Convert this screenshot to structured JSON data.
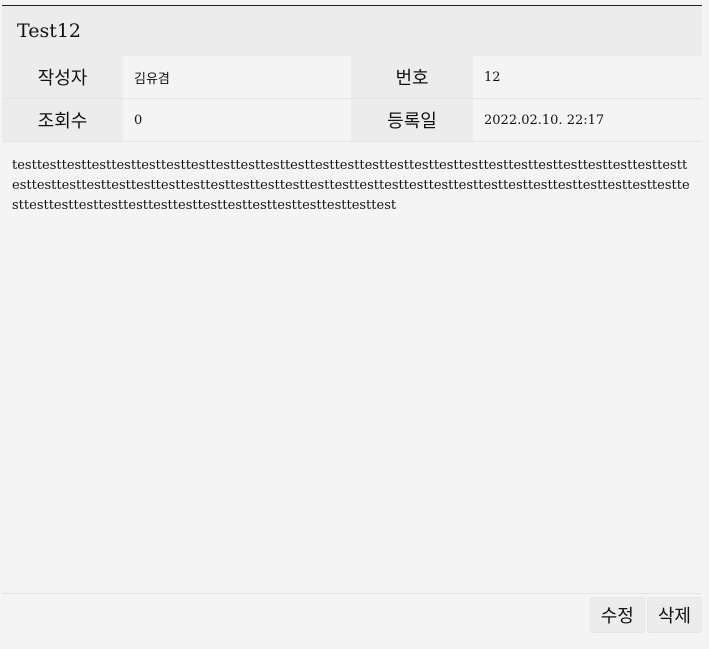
{
  "post": {
    "title": "Test12",
    "meta": {
      "author_label": "작성자",
      "author_value": "김유겸",
      "number_label": "번호",
      "number_value": "12",
      "views_label": "조회수",
      "views_value": "0",
      "date_label": "등록일",
      "date_value": "2022.02.10. 22:17"
    },
    "content": "testtesttesttesttesttesttesttesttesttesttesttesttesttesttesttesttesttesttesttesttesttesttesttesttesttesttesttesttesttesttesttesttesttesttesttesttesttesttesttesttesttesttesttesttesttesttesttesttesttesttesttesttesttesttesttesttesttesttesttesttesttesttesttesttesttesttesttesttesttest"
  },
  "actions": {
    "edit_label": "수정",
    "delete_label": "삭제"
  }
}
